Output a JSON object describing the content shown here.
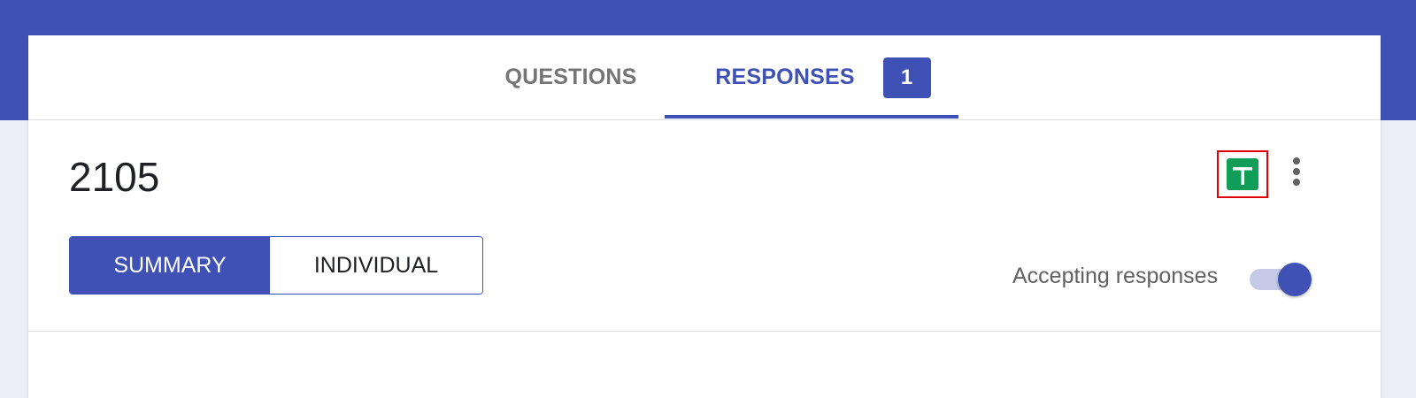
{
  "tabs": {
    "questions_label": "QUESTIONS",
    "responses_label": "RESPONSES",
    "responses_count": "1",
    "active": "RESPONSES"
  },
  "responses": {
    "count_title": "2105",
    "view_toggle": {
      "summary_label": "SUMMARY",
      "individual_label": "INDIVIDUAL",
      "selected": "SUMMARY"
    },
    "accepting_label": "Accepting responses",
    "accepting_on": true
  },
  "icons": {
    "sheets": "google-sheets-icon",
    "more": "more-vert-icon"
  },
  "colors": {
    "brand": "#3f51b5",
    "sheets_green": "#0f9d58",
    "highlight_border": "#e00000",
    "toggle_track": "#c5cae9"
  }
}
